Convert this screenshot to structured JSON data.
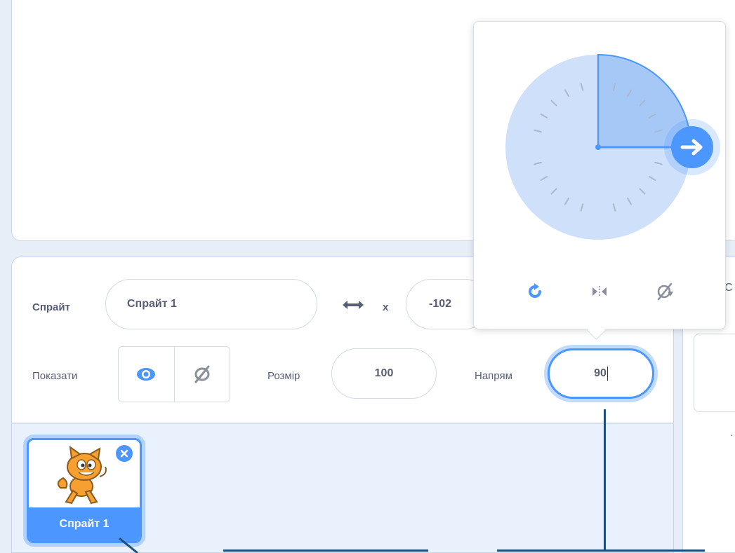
{
  "sprite_info": {
    "sprite_label": "Спрайт",
    "sprite_name": "Спрайт 1",
    "x_label": "x",
    "x_value": "-102",
    "show_label": "Показати",
    "size_label": "Розмір",
    "size_value": "100",
    "direction_label": "Напрям",
    "direction_value": "90"
  },
  "sprite_list": {
    "items": [
      {
        "name": "Спрайт 1",
        "selected": true
      }
    ]
  },
  "direction_popover": {
    "direction_degrees": 90,
    "modes": [
      "all-around-icon",
      "left-right-icon",
      "dont-rotate-icon"
    ]
  },
  "right_panel": {
    "partial_text": "С",
    "partial_dot": "·"
  },
  "colors": {
    "accent": "#4c97ff",
    "dial_fill": "#cfe0fb",
    "text": "#575e75",
    "callout": "#1e4f7c"
  }
}
